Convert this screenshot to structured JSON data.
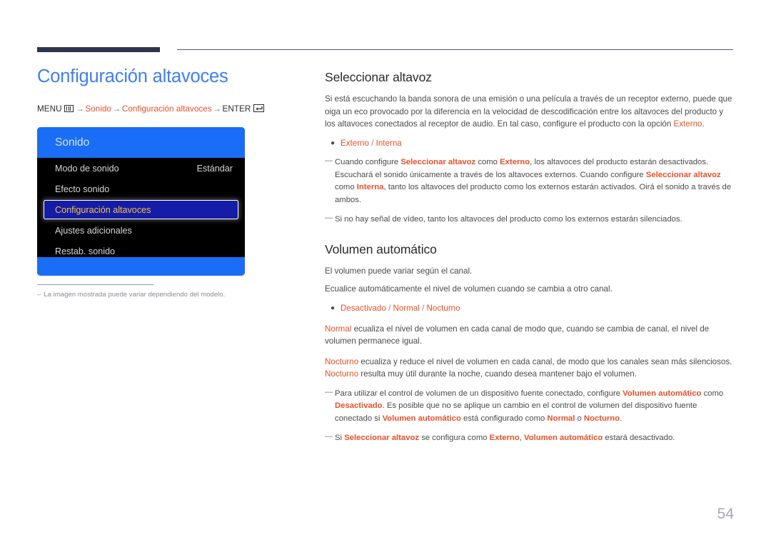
{
  "page": {
    "number": "54",
    "title": "Configuración altavoces"
  },
  "breadcrumb": {
    "menu_label": "MENU",
    "menu_icon": "menu-bars-icon",
    "arrow": "→",
    "item1": "Sonido",
    "item2": "Configuración altavoces",
    "enter_label": "ENTER",
    "enter_icon": "enter-return-icon"
  },
  "osd": {
    "header": "Sonido",
    "rows": [
      {
        "label": "Modo de sonido",
        "value": "Estándar",
        "selected": false
      },
      {
        "label": "Efecto sonido",
        "value": "",
        "selected": false
      },
      {
        "label": "Configuración altavoces",
        "value": "",
        "selected": true
      },
      {
        "label": "Ajustes adicionales",
        "value": "",
        "selected": false
      },
      {
        "label": "Restab. sonido",
        "value": "",
        "selected": false
      }
    ]
  },
  "caption": {
    "dash": "‒",
    "text": "La imagen mostrada puede variar dependiendo del modelo."
  },
  "sections": {
    "select_speaker": {
      "title": "Seleccionar altavoz",
      "intro_a": "Si está escuchando la banda sonora de una emisión o una película a través de un receptor externo, puede que oiga un eco provocado por la diferencia en la velocidad de descodificación entre los altavoces del producto y los altavoces conectados al receptor de audio. En tal caso, configure el producto con la opción ",
      "intro_b": "Externo",
      "intro_c": ".",
      "bullet": {
        "opt1": "Externo",
        "sep": " / ",
        "opt2": "Interna"
      },
      "note1": {
        "p1": "Cuando configure ",
        "t1": "Seleccionar altavoz",
        "p2": " como ",
        "t2": "Externo",
        "p3": ", los altavoces del producto estarán desactivados. Escuchará el sonido únicamente a través de los altavoces externos. Cuando configure ",
        "t3": "Seleccionar altavoz",
        "p4": " como ",
        "t4": "Interna",
        "p5": ", tanto los altavoces del producto como los externos estarán activados. Oirá el sonido a través de ambos."
      },
      "note2": "Si no hay señal de vídeo, tanto los altavoces del producto como los externos estarán silenciados."
    },
    "auto_volume": {
      "title": "Volumen automático",
      "para1": "El volumen puede variar según el canal.",
      "para2": "Ecualice automáticamente el nivel de volumen cuando se cambia a otro canal.",
      "bullet": {
        "opt1": "Desactivado",
        "sep1": " / ",
        "opt2": "Normal",
        "sep2": " / ",
        "opt3": "Nocturno"
      },
      "normal": {
        "term": "Normal",
        "text": " ecualiza el nivel de volumen en cada canal de modo que, cuando se cambia de canal, el nivel de volumen permanece igual."
      },
      "nocturno": {
        "term1": "Nocturno",
        "text1": " ecualiza y reduce el nivel de volumen en cada canal, de modo que los canales sean más silenciosos. ",
        "term2": "Nocturno",
        "text2": " resulta muy útil durante la noche, cuando desea mantener bajo el volumen."
      },
      "note1": {
        "p1": "Para utilizar el control de volumen de un dispositivo fuente conectado, configure ",
        "t1": "Volumen automático",
        "p2": " como ",
        "t2": "Desactivado",
        "p3": ". Es posible que no se aplique un cambio en el control de volumen del dispositivo fuente conectado si ",
        "t3": "Volumen automático",
        "p4": " está configurado como ",
        "t4": "Normal",
        "p5": " o ",
        "t5": "Nocturno",
        "p6": "."
      },
      "note2": {
        "p1": "Si ",
        "t1": "Seleccionar altavoz",
        "p2": " se configura como ",
        "t2": "Externo",
        "p3": ", ",
        "t3": "Volumen automático",
        "p4": " estará desactivado."
      }
    }
  },
  "colors": {
    "accent_blue": "#3d7ff0",
    "accent_orange": "#ea4f28",
    "navy_rule": "#2e3350",
    "osd_blue": "#1a6ef5",
    "osd_selected_bg": "#141ca8",
    "osd_selected_text": "#f5c43c"
  }
}
